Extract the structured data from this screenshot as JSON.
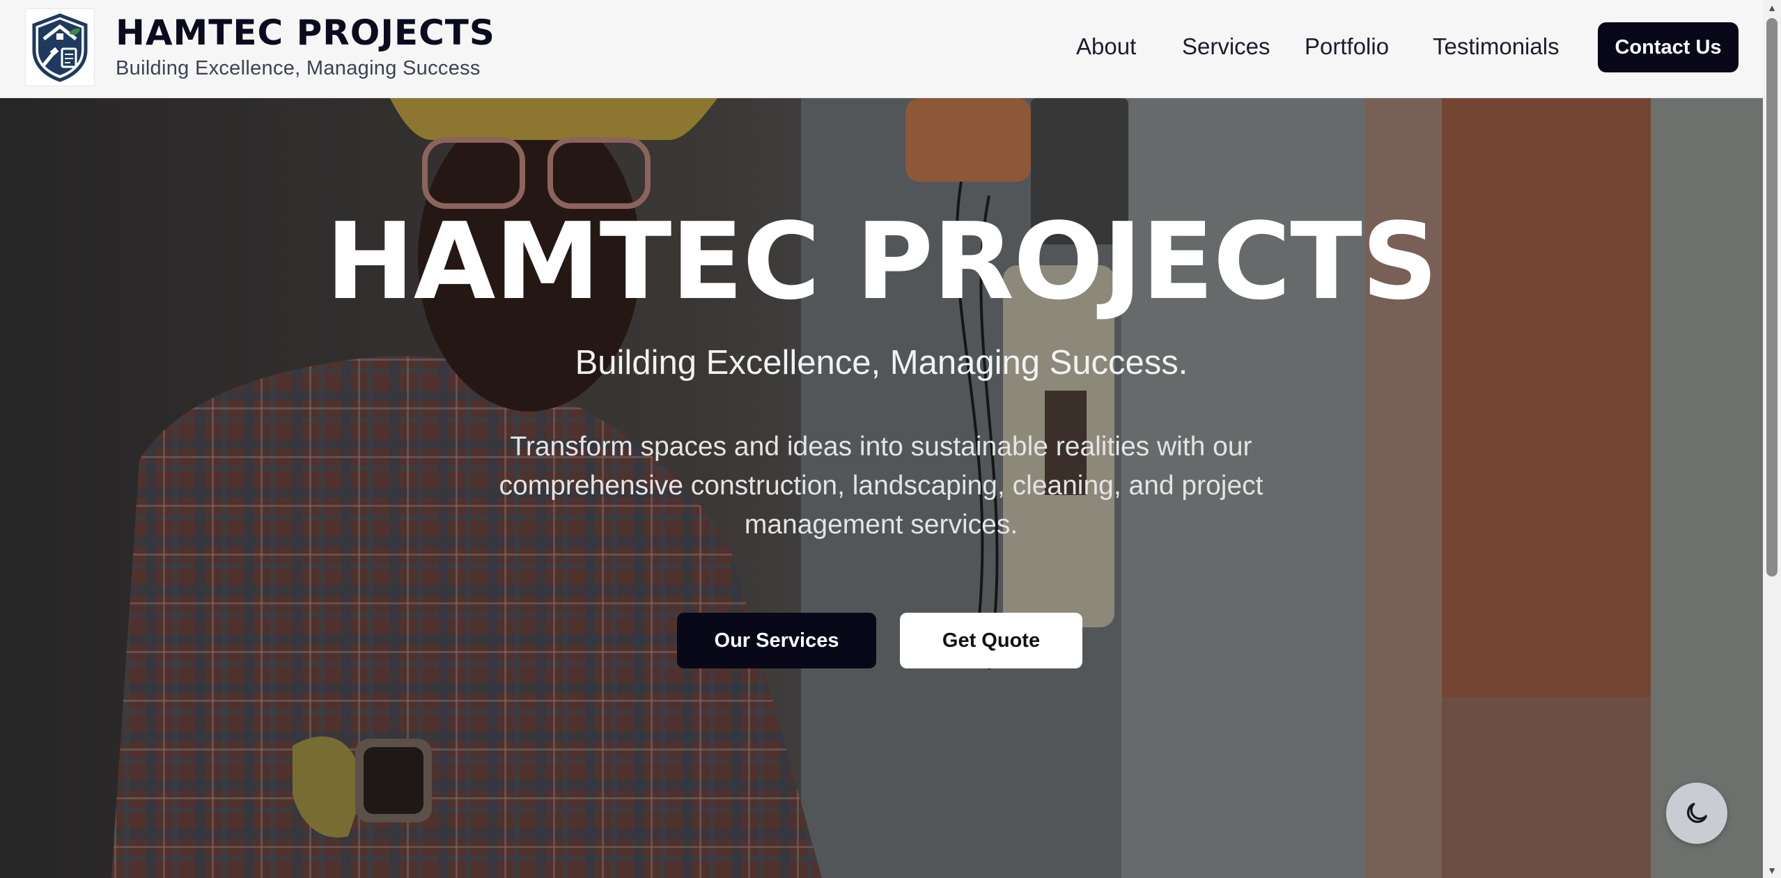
{
  "header": {
    "brand_title": "HAMTEC PROJECTS",
    "brand_subtitle": "Building Excellence, Managing Success",
    "logo_icon": "house-shield-logo",
    "nav": [
      {
        "label": "About"
      },
      {
        "label": "Services"
      },
      {
        "label": "Portfolio"
      },
      {
        "label": "Testimonials"
      }
    ],
    "contact_label": "Contact Us"
  },
  "hero": {
    "title": "HAMTEC PROJECTS",
    "tagline": "Building Excellence, Managing Success.",
    "description": "Transform spaces and ideas into sustainable realities with our comprehensive construction, landscaping, cleaning, and project management services.",
    "primary_button": "Our Services",
    "secondary_button": "Get Quote",
    "background": "worker-in-hard-hat-photo"
  },
  "theme_toggle": {
    "icon": "moon-icon"
  },
  "colors": {
    "primary": "#080819",
    "header_bg": "#f6f6f7",
    "toggle_bg": "#c9cdd3",
    "logo_navy": "#1e3a5f",
    "logo_green": "#3d8b3d"
  }
}
